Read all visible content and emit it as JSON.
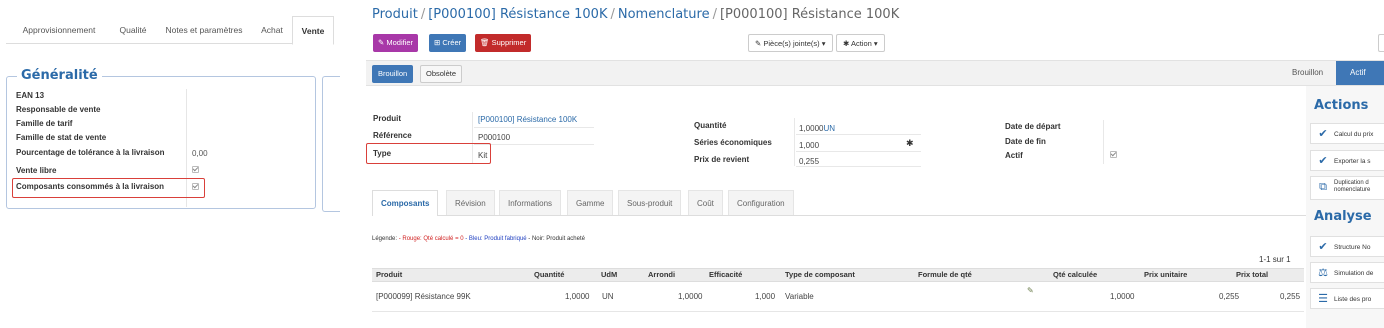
{
  "left_panel": {
    "tabs": [
      "Approvisionnement",
      "Qualité",
      "Notes et paramètres",
      "Achat",
      "Vente"
    ],
    "section_title": "Généralité",
    "fields": [
      {
        "label": "EAN 13",
        "value": ""
      },
      {
        "label": "Responsable de vente",
        "value": ""
      },
      {
        "label": "Famille de tarif",
        "value": ""
      },
      {
        "label": "Famille de stat de vente",
        "value": ""
      },
      {
        "label": "Pourcentage de tolérance à la livraison",
        "value": "0,00"
      },
      {
        "label": "Vente libre",
        "value": "checked"
      },
      {
        "label": "Composants consommés à la livraison",
        "value": "checked"
      }
    ]
  },
  "breadcrumb": {
    "items": [
      "Produit",
      "[P000100] Résistance 100K",
      "Nomenclature"
    ],
    "separator": "/",
    "current": "[P000100] Résistance 100K"
  },
  "toolbar": {
    "edit": "Modifier",
    "create": "Créer",
    "delete": "Supprimer",
    "attachments": "Pièce(s) jointe(s)",
    "action": "Action"
  },
  "status": {
    "buttons": [
      "Brouillon",
      "Obsolète"
    ],
    "stages": [
      "Brouillon",
      "Actif"
    ]
  },
  "form": {
    "produit_label": "Produit",
    "produit_value": "[P000100] Résistance 100K",
    "reference_label": "Référence",
    "reference_value": "P000100",
    "type_label": "Type",
    "type_value": "Kit",
    "quantite_label": "Quantité",
    "quantite_value": "1,0000",
    "quantite_unit": "UN",
    "series_label": "Séries économiques",
    "series_value": "1,000",
    "prix_label": "Prix de revient",
    "prix_value": "0,255",
    "date_depart_label": "Date de départ",
    "date_fin_label": "Date de fin",
    "actif_label": "Actif",
    "actif_value": "checked"
  },
  "tabs": [
    "Composants",
    "Révision",
    "Informations",
    "Gamme",
    "Sous-produit",
    "Coût",
    "Configuration"
  ],
  "legend": {
    "prefix": "Légende:",
    "red": "- Rouge: Qté calculé = 0",
    "blue": "- Bleu: Produit fabriqué",
    "black": "- Noir: Produit acheté"
  },
  "pager": "1-1 sur 1",
  "table": {
    "columns": [
      "Produit",
      "Quantité",
      "UdM",
      "Arrondi",
      "Efficacité",
      "Type de composant",
      "Formule de qté",
      "Qté calculée",
      "Prix unitaire",
      "Prix total"
    ],
    "rows": [
      {
        "produit": "[P000099] Résistance 99K",
        "quantite": "1,0000",
        "udm": "UN",
        "arrondi": "1,0000",
        "efficacite": "1,000",
        "type": "Variable",
        "formule": "",
        "qte_calc": "1,0000",
        "prix_unit": "0,255",
        "prix_total": "0,255"
      }
    ]
  },
  "sidebar": {
    "actions_title": "Actions",
    "actions": [
      "Calcul du prix",
      "Exporter la s",
      "Duplication d",
      "nomenclature"
    ],
    "analyse_title": "Analyse",
    "analyse": [
      "Structure No",
      "Simulation de",
      "Liste des pro"
    ]
  },
  "colors": {
    "accent": "#2b6aa8",
    "edit_button": "#a838a8",
    "create_button": "#3f77b6",
    "delete_button": "#c22b2b",
    "highlight_box": "#d9403a"
  }
}
